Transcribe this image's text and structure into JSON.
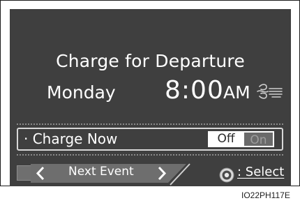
{
  "departure": {
    "title": "Charge for Departure",
    "day": "Monday",
    "time": "8:00",
    "ampm": "AM",
    "climate_icon": "climate-fan-icon"
  },
  "charge_now": {
    "label": "· Charge Now",
    "off_label": "Off",
    "on_label": "On",
    "selected": "Off"
  },
  "bottom": {
    "prev_icon": "chevron-left-icon",
    "next_label": "Next Event",
    "next_icon": "chevron-right-icon",
    "knob_icon": "dial-knob-icon",
    "select_label": ": Select"
  },
  "figure_id": "IO22PH117E",
  "colors": {
    "screen_bg": "#3f3f3f",
    "text": "#ffffff",
    "toggle_selected_bg": "#ffffff",
    "toggle_unselected_bg": "#6a6a6a"
  }
}
